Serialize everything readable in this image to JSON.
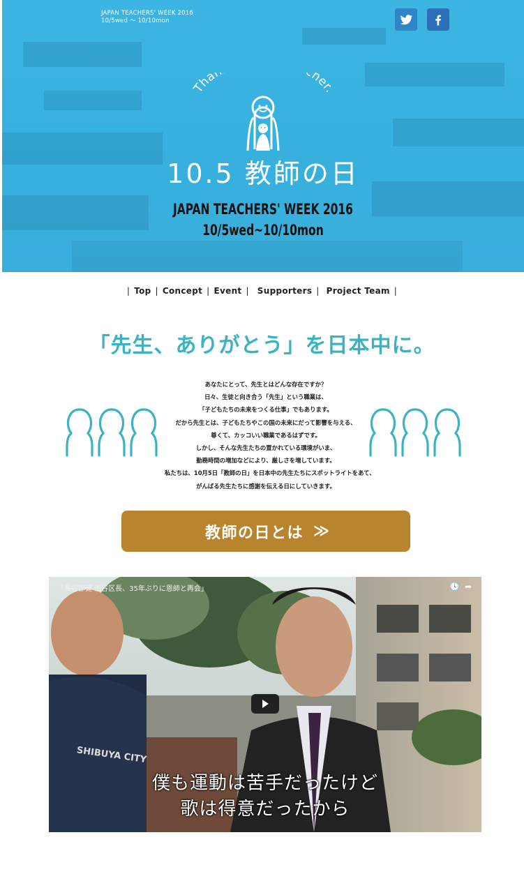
{
  "hero": {
    "tag_line1": "JAPAN TEACHERS' WEEK 2016",
    "tag_line2": "10/5wed 〜 10/10mon",
    "logo_arc_text": "Thank you. My teacher.",
    "title": "10.5 教師の日",
    "subtitle1": "JAPAN TEACHERS' WEEK 2016",
    "subtitle2": "10/5wed~10/10mon",
    "background_color": "#3cb5e2",
    "social_icons": [
      "twitter-icon",
      "facebook-icon"
    ]
  },
  "nav": {
    "items": [
      "Top",
      "Concept",
      "Event",
      "Supporters",
      "Project Team"
    ]
  },
  "headline": "「先生、ありがとう」を日本中に。",
  "intro": [
    "あなたにとって、先生とはどんな存在ですか？",
    "日々、生徒と向き合う「先生」という職業は、",
    "「子どもたちの未来をつくる仕事」でもあります。",
    "だから先生とは、子どもたちやこの国の未来にだって影響を与える、",
    "尊くて、カッコいい職業であるはずです。",
    "しかし、そんな先生たちの置かれている環境がいま、",
    "勤務時間の増加などにより、厳しさを増しています。",
    "私たちは、10月5日「教師の日」を日本中の先生たちにスポットライトをあて、",
    "がんばる先生たちに感謝を伝える日にしていきます。"
  ],
  "cta": {
    "label": "教師の日とは",
    "arrow": "≫",
    "color": "#b8842e"
  },
  "video": {
    "title": "「長谷部健 渋谷区長、35年ぶりに恩師と再会」",
    "subtitle_line1": "僕も運動は苦手だったけど",
    "subtitle_line2": "歌は得意だったから",
    "shirt_text": "SHIBUYA CITY"
  },
  "colors": {
    "accent_teal": "#3bb3c0",
    "hero_blue": "#3cb5e2",
    "cta_gold": "#b8842e"
  }
}
